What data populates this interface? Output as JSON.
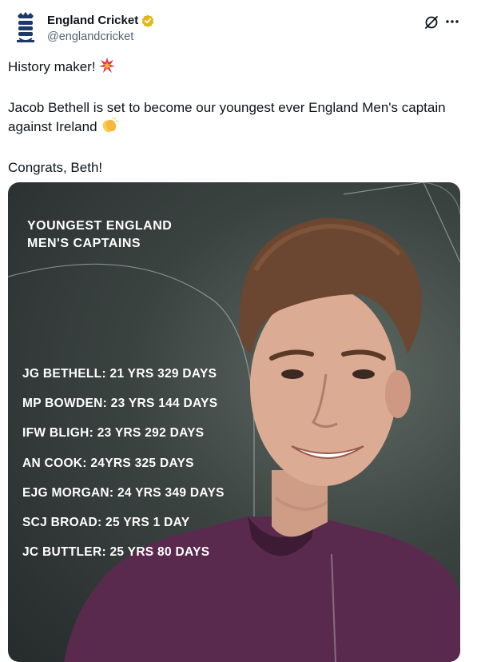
{
  "post": {
    "author_name": "England Cricket",
    "handle": "@englandcricket",
    "paragraph1": "History maker!",
    "paragraph2": "Jacob Bethell is set to become our youngest ever England Men's captain against Ireland",
    "paragraph3": "Congrats, Beth!"
  },
  "media": {
    "title_line1": "YOUNGEST ENGLAND",
    "title_line2": "MEN'S CAPTAINS",
    "captains": [
      "JG BETHELL: 21 YRS 329 DAYS",
      "MP BOWDEN: 23 YRS 144 DAYS",
      "IFW BLIGH: 23 YRS 292 DAYS",
      "AN COOK: 24YRS 325 DAYS",
      "EJG MORGAN: 24 YRS 349 DAYS",
      "SCJ BROAD: 25 YRS 1 DAY",
      "JC BUTTLER: 25 YRS 80 DAYS"
    ]
  },
  "icons": {
    "verified": "verified-badge-icon",
    "grok": "grok-icon",
    "more": "more-options-icon",
    "emoji1": "collision-emoji",
    "emoji2": "clapping-hands-emoji"
  },
  "colors": {
    "verified_badge": "#e2b719",
    "jersey": "#5a2a4e",
    "image_background": "#3b4341",
    "handle_text": "#536471"
  }
}
